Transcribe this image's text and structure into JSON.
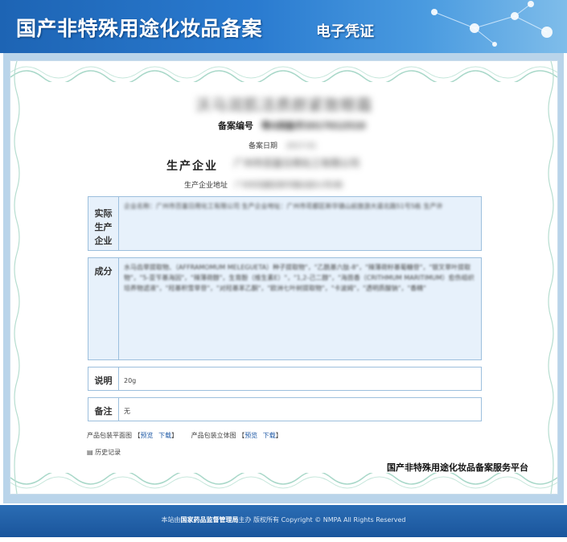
{
  "banner": {
    "title": "国产非特殊用途化妆品备案",
    "subtitle": "电子凭证"
  },
  "certificate": {
    "product_name": "沃马润肌活质颜紧致眼霜",
    "registration": {
      "label": "备案编号",
      "value": "粤G网备字2017012510"
    },
    "date": {
      "label": "备案日期",
      "value": "2017-01"
    },
    "enterprise": {
      "label": "生产企业",
      "value": "广州市百富日用化工有限公司"
    },
    "address": {
      "label": "生产企业地址",
      "value": "广州市花都区新华镇北街51号5栋"
    },
    "actual_producer": {
      "label": "实际生产企业",
      "value": "企业名称：广州市百富日用化工有限公司    生产企业地址：广州市花都区新华镇山前旅游大道北路51号5栋    生产许"
    },
    "ingredients": {
      "label": "成分",
      "value": "水马齿草提取物、（AFFRAMOMUM MELEGUETA）种子提取物\"，\"乙酰基六肽-8\"，\"辣薄荷籽基葡糖苷\"，\"银叉草叶提取物\"，\"5-亚苄基海因\"，\"辣薄荷醇\"，生育酚（维生素E）\"，\"1,2-己二醇\"，\"海茴香（CRITHMUM MARITIMUM）愈伤组织培养物滤液\"，\"羟基积雪草苷\"，\"对羟基苯乙酮\"，\"欧洲七叶树提取物\"，\"卡波姆\"，\"透明质酸钠\"，\"香精\""
    },
    "description": {
      "label": "说明",
      "value": "20g"
    },
    "remarks": {
      "label": "备注",
      "value": "无"
    },
    "links": {
      "plan_label": "产品包装平面图",
      "cube_label": "产品包装立体图",
      "preview": "预览",
      "download": "下载"
    },
    "history": "历史记录",
    "platform": "国产非特殊用途化妆品备案服务平台"
  },
  "footer": {
    "prefix": "本站由",
    "org": "国家药品监督管理局",
    "suffix": "主办 版权所有 Copyright © NMPA All Rights Reserved"
  }
}
